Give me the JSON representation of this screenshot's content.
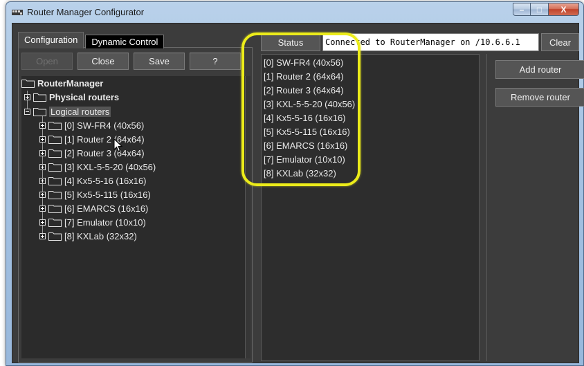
{
  "window": {
    "title": "Router Manager Configurator",
    "minimize_glyph": "–",
    "maximize_glyph": "□",
    "close_glyph": "X"
  },
  "tabs": [
    {
      "label": "Configuration",
      "active": true
    },
    {
      "label": "Dynamic Control",
      "active": false
    }
  ],
  "toolbar": {
    "open_label": "Open",
    "close_label": "Close",
    "save_label": "Save",
    "help_label": "?"
  },
  "tree": {
    "root": "RouterManager",
    "physical": "Physical routers",
    "logical": "Logical routers",
    "logical_children": [
      "[0] SW-FR4 (40x56)",
      "[1] Router 2 (64x64)",
      "[2] Router 3 (64x64)",
      "[3] KXL-5-5-20 (40x56)",
      "[4] Kx5-5-16 (16x16)",
      "[5] Kx5-5-115 (16x16)",
      "[6] EMARCS (16x16)",
      "[7] Emulator (10x10)",
      "[8] KXLab (32x32)"
    ]
  },
  "status": {
    "button_label": "Status",
    "text": "Connected to RouterManager on /10.6.6.1",
    "clear_label": "Clear"
  },
  "router_list": [
    "[0] SW-FR4 (40x56)",
    "[1] Router 2 (64x64)",
    "[2] Router 3 (64x64)",
    "[3] KXL-5-5-20 (40x56)",
    "[4] Kx5-5-16 (16x16)",
    "[5] Kx5-5-115 (16x16)",
    "[6] EMARCS (16x16)",
    "[7] Emulator (10x10)",
    "[8] KXLab (32x32)"
  ],
  "actions": {
    "add_label": "Add router",
    "remove_label": "Remove router"
  },
  "colors": {
    "panel_bg": "#3c3c3c",
    "highlight_ring": "#ecec1a"
  }
}
